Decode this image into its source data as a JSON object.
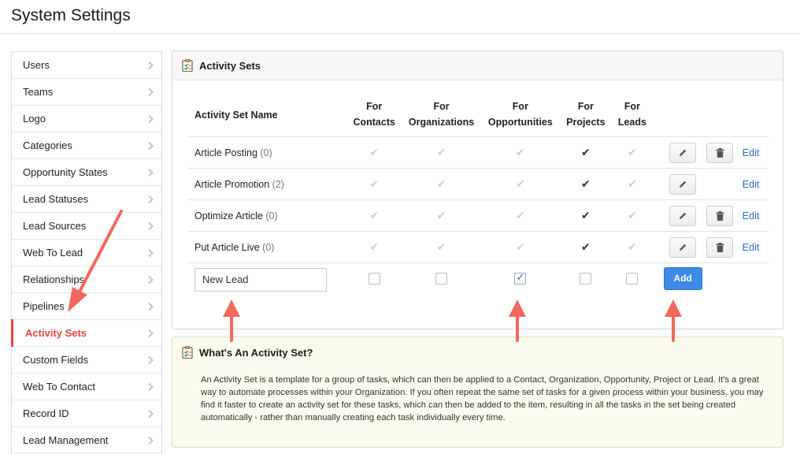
{
  "header": {
    "title": "System Settings"
  },
  "sidebar": {
    "items": [
      {
        "label": "Users"
      },
      {
        "label": "Teams"
      },
      {
        "label": "Logo"
      },
      {
        "label": "Categories"
      },
      {
        "label": "Opportunity States"
      },
      {
        "label": "Lead Statuses"
      },
      {
        "label": "Lead Sources"
      },
      {
        "label": "Web To Lead"
      },
      {
        "label": "Relationships"
      },
      {
        "label": "Pipelines"
      },
      {
        "label": "Activity Sets",
        "active": true
      },
      {
        "label": "Custom Fields"
      },
      {
        "label": "Web To Contact"
      },
      {
        "label": "Record ID"
      },
      {
        "label": "Lead Management"
      }
    ]
  },
  "panel": {
    "title": "Activity Sets",
    "columns": {
      "name": "Activity Set Name",
      "contacts": [
        "For",
        "Contacts"
      ],
      "organizations": [
        "For",
        "Organizations"
      ],
      "opportunities": [
        "For",
        "Opportunities"
      ],
      "projects": [
        "For",
        "Projects"
      ],
      "leads": [
        "For",
        "Leads"
      ]
    },
    "rows": [
      {
        "name": "Article Posting",
        "count": "(0)",
        "checks": [
          false,
          false,
          false,
          true,
          false
        ],
        "has_delete": true,
        "edit_label": "Edit"
      },
      {
        "name": "Article Promotion",
        "count": "(2)",
        "checks": [
          false,
          false,
          false,
          true,
          false
        ],
        "has_delete": false,
        "edit_label": "Edit"
      },
      {
        "name": "Optimize Article",
        "count": "(0)",
        "checks": [
          false,
          false,
          false,
          true,
          false
        ],
        "has_delete": true,
        "edit_label": "Edit"
      },
      {
        "name": "Put Article Live",
        "count": "(0)",
        "checks": [
          false,
          false,
          false,
          true,
          false
        ],
        "has_delete": true,
        "edit_label": "Edit"
      }
    ],
    "new_row": {
      "input_value": "New Lead",
      "checks": [
        false,
        false,
        true,
        false,
        false
      ],
      "add_label": "Add"
    },
    "icons": {
      "pencil": "pencil-icon",
      "trash": "trash-icon",
      "check": "checkmark-icon"
    }
  },
  "info": {
    "title": "What's An Activity Set?",
    "text": "An Activity Set is a template for a group of tasks, which can then be applied to a Contact, Organization, Opportunity, Project or Lead. It's a great way to automate processes within your Organization. If you often repeat the same set of tasks for a given process within your business, you may find it faster to create an activity set for these tasks, which can then be added to the item, resulting in all the tasks in the set being created automatically - rather than manually creating each task individually every time."
  },
  "colors": {
    "accent_red": "#e2473c",
    "annotation_arrow": "#f2695c",
    "add_button": "#3d8ae8",
    "edit_link": "#2a6fbf",
    "info_bg": "#fbfcee"
  }
}
